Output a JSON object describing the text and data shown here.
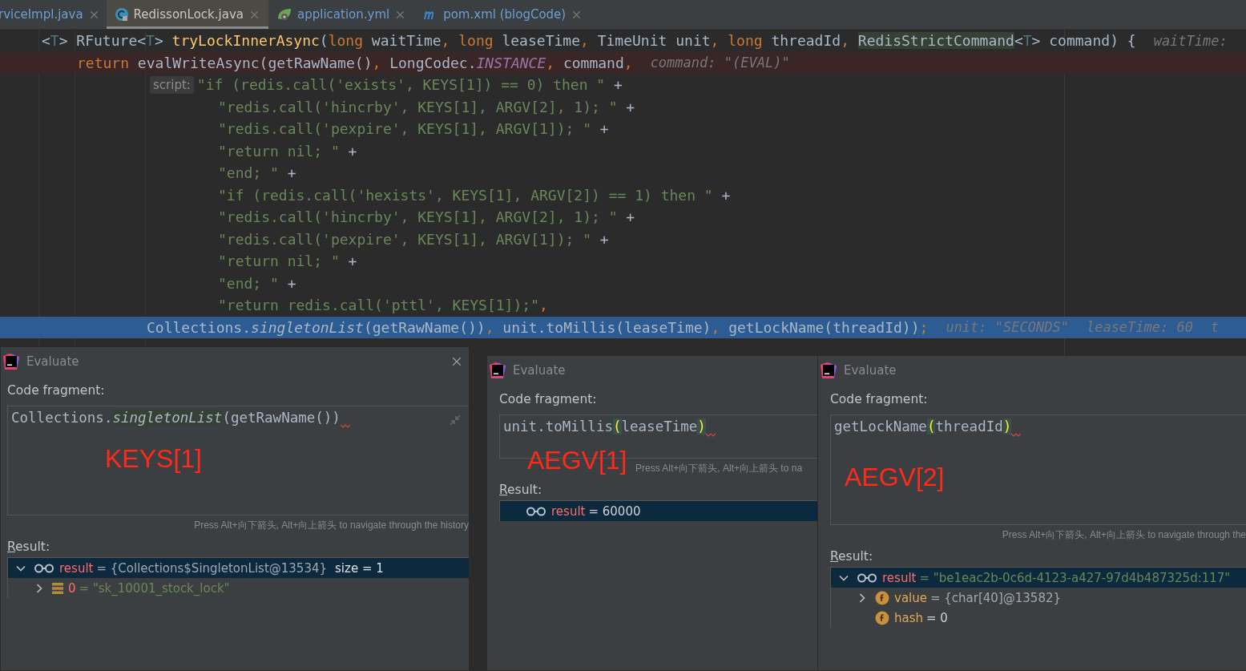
{
  "tabs": [
    {
      "label": "rviceImpl.java",
      "kind": "cut",
      "color": "#6d9ed4",
      "selected": false
    },
    {
      "label": "RedissonLock.java",
      "kind": "class",
      "color": "#c8c8c8",
      "selected": true
    },
    {
      "label": "application.yml",
      "kind": "yaml",
      "color": "#6d9ed4",
      "selected": false
    },
    {
      "label": "pom.xml (blogCode)",
      "kind": "maven",
      "color": "#6d9ed4",
      "selected": false
    }
  ],
  "lines": [
    {
      "kind": "sig",
      "breakpoint": false,
      "current": false,
      "tokens": [
        {
          "t": "<",
          "kind": "plain"
        },
        {
          "t": "T",
          "kind": "tp"
        },
        {
          "t": "> RFuture<",
          "kind": "plain"
        },
        {
          "t": "T",
          "kind": "tp"
        },
        {
          "t": "> ",
          "kind": "plain"
        },
        {
          "t": "tryLockInnerAsync",
          "kind": "method"
        },
        {
          "t": "(",
          "kind": "plain"
        },
        {
          "t": "long",
          "kind": "kw"
        },
        {
          "t": " waitTime",
          "kind": "plain"
        },
        {
          "t": ", long",
          "kind": "kw"
        },
        {
          "t": " leaseTime",
          "kind": "plain"
        },
        {
          "t": ", ",
          "kind": "kw"
        },
        {
          "t": "TimeUnit unit",
          "kind": "plain"
        },
        {
          "t": ", long",
          "kind": "kw"
        },
        {
          "t": " threadId",
          "kind": "plain"
        },
        {
          "t": ", ",
          "kind": "kw"
        },
        {
          "t": "RedisStrictCommand",
          "kind": "hltype"
        },
        {
          "t": "<",
          "kind": "plain"
        },
        {
          "t": "T",
          "kind": "tp"
        },
        {
          "t": "> command) {",
          "kind": "plain"
        },
        {
          "t": "waitTime:",
          "kind": "hint"
        }
      ]
    },
    {
      "kind": "stmt",
      "breakpoint": true,
      "current": false,
      "tokens": [
        {
          "t": "return",
          "kind": "kw"
        },
        {
          "t": " evalWriteAsync(getRawName()",
          "kind": "plain"
        },
        {
          "t": ", ",
          "kind": "kw"
        },
        {
          "t": "LongCodec.",
          "kind": "plain"
        },
        {
          "t": "INSTANCE",
          "kind": "const"
        },
        {
          "t": ", ",
          "kind": "kw"
        },
        {
          "t": "command",
          "kind": "plain"
        },
        {
          "t": ",",
          "kind": "kw"
        },
        {
          "t": "command: \"(EVAL)\"",
          "kind": "hint"
        }
      ]
    },
    {
      "kind": "script_first",
      "breakpoint": false,
      "current": false,
      "tokens": [
        {
          "t": "script:",
          "kind": "label"
        },
        {
          "t": "\"if (redis.call('exists', KEYS[1]) == 0) then \"",
          "kind": "str"
        },
        {
          "t": " +",
          "kind": "plain"
        }
      ]
    },
    {
      "kind": "script",
      "breakpoint": false,
      "current": false,
      "tokens": [
        {
          "t": "\"redis.call('hincrby', KEYS[1], ARGV[2], 1); \"",
          "kind": "str"
        },
        {
          "t": " +",
          "kind": "plain"
        }
      ]
    },
    {
      "kind": "script",
      "breakpoint": false,
      "current": false,
      "tokens": [
        {
          "t": "\"redis.call('pexpire', KEYS[1], ARGV[1]); \"",
          "kind": "str"
        },
        {
          "t": " +",
          "kind": "plain"
        }
      ]
    },
    {
      "kind": "script",
      "breakpoint": false,
      "current": false,
      "tokens": [
        {
          "t": "\"return nil; \"",
          "kind": "str"
        },
        {
          "t": " +",
          "kind": "plain"
        }
      ]
    },
    {
      "kind": "script",
      "breakpoint": false,
      "current": false,
      "tokens": [
        {
          "t": "\"end; \"",
          "kind": "str"
        },
        {
          "t": " +",
          "kind": "plain"
        }
      ]
    },
    {
      "kind": "script",
      "breakpoint": false,
      "current": false,
      "tokens": [
        {
          "t": "\"if (redis.call('hexists', KEYS[1], ARGV[2]) == 1) then \"",
          "kind": "str"
        },
        {
          "t": " +",
          "kind": "plain"
        }
      ]
    },
    {
      "kind": "script",
      "breakpoint": false,
      "current": false,
      "tokens": [
        {
          "t": "\"redis.call('hincrby', KEYS[1], ARGV[2], 1); \"",
          "kind": "str"
        },
        {
          "t": " +",
          "kind": "plain"
        }
      ]
    },
    {
      "kind": "script",
      "breakpoint": false,
      "current": false,
      "tokens": [
        {
          "t": "\"redis.call('pexpire', KEYS[1], ARGV[1]); \"",
          "kind": "str"
        },
        {
          "t": " +",
          "kind": "plain"
        }
      ]
    },
    {
      "kind": "script",
      "breakpoint": false,
      "current": false,
      "tokens": [
        {
          "t": "\"return nil; \"",
          "kind": "str"
        },
        {
          "t": " +",
          "kind": "plain"
        }
      ]
    },
    {
      "kind": "script",
      "breakpoint": false,
      "current": false,
      "tokens": [
        {
          "t": "\"end; \"",
          "kind": "str"
        },
        {
          "t": " +",
          "kind": "plain"
        }
      ]
    },
    {
      "kind": "script",
      "breakpoint": false,
      "current": false,
      "tokens": [
        {
          "t": "\"return redis.call('pttl', KEYS[1]);\"",
          "kind": "str"
        },
        {
          "t": ",",
          "kind": "kw"
        }
      ]
    },
    {
      "kind": "args",
      "breakpoint": false,
      "current": true,
      "tokens": [
        {
          "t": "Collections.",
          "kind": "plain"
        },
        {
          "t": "singletonList",
          "kind": "ital"
        },
        {
          "t": "(getRawName())",
          "kind": "plain"
        },
        {
          "t": ", ",
          "kind": "kw"
        },
        {
          "t": "unit.toMillis(leaseTime)",
          "kind": "plain"
        },
        {
          "t": ", ",
          "kind": "kw"
        },
        {
          "t": "getLockName(threadId))",
          "kind": "plain"
        },
        {
          "t": ";",
          "kind": "kw"
        },
        {
          "t": "unit: \"SECONDS\"",
          "kind": "hint"
        },
        {
          "t": "leaseTime: 60",
          "kind": "hint"
        },
        {
          "t": "t",
          "kind": "hint"
        }
      ]
    }
  ],
  "dialogs": [
    {
      "title": "Evaluate",
      "closable": true,
      "fragment_label": "Code fragment:",
      "code": [
        {
          "t": "Collections.",
          "kind": "plain"
        },
        {
          "t": "singletonList",
          "kind": "italhl"
        },
        {
          "t": "(getRawName())",
          "kind": "plain"
        }
      ],
      "annotation": "KEYS[1]",
      "hint": "Press Alt+向下箭头, Alt+向上箭头 to navigate through the history",
      "result_label": "Result:",
      "results": [
        {
          "kind": "watch",
          "name": "result",
          "value": "= {Collections$SingletonList@13534}",
          "color": "#a0a8b0",
          "extra": "size = 1",
          "selected": true,
          "expanded": true,
          "children": [
            {
              "kind": "array",
              "name": "0",
              "value": "= \"sk_10001_stock_lock\"",
              "color": "#6a8759",
              "selected": false,
              "expanded": false
            }
          ]
        }
      ]
    },
    {
      "title": "Evaluate",
      "closable": false,
      "fragment_label": "Code fragment:",
      "code": [
        {
          "t": "unit.toMillis",
          "kind": "plain"
        },
        {
          "t": "(",
          "kind": "paren"
        },
        {
          "t": "leaseTime",
          "kind": "plain"
        },
        {
          "t": ")",
          "kind": "paren"
        }
      ],
      "annotation": "AEGV[1]",
      "hint": "Press Alt+向下箭头, Alt+向上箭头 to na",
      "result_label": "Result:",
      "results": [
        {
          "kind": "watch",
          "name": "result",
          "value": "= 60000",
          "color": "#d0d0d0",
          "selected": true
        }
      ]
    },
    {
      "title": "Evaluate",
      "closable": false,
      "fragment_label": "Code fragment:",
      "code": [
        {
          "t": "getLockName",
          "kind": "plain"
        },
        {
          "t": "(",
          "kind": "paren"
        },
        {
          "t": "threadId",
          "kind": "plain"
        },
        {
          "t": ")",
          "kind": "paren"
        }
      ],
      "annotation": "AEGV[2]",
      "hint": "Press Alt+向下箭头, Alt+向上箭头 to navigate through the",
      "result_label": "Result:",
      "results": [
        {
          "kind": "watch",
          "name": "result",
          "value": "= \"be1eac2b-0c6d-4123-a427-97d4b487325d:117\"",
          "color": "#6a8759",
          "selected": true,
          "expanded": true,
          "children": [
            {
              "kind": "field",
              "name": "value",
              "value": "= {char[40]@13582}",
              "color": "#a0a8b0",
              "selected": false,
              "expanded": false
            },
            {
              "kind": "field",
              "name": "hash",
              "value": "= 0",
              "color": "#d0d0d0",
              "selected": false
            }
          ]
        }
      ]
    }
  ]
}
